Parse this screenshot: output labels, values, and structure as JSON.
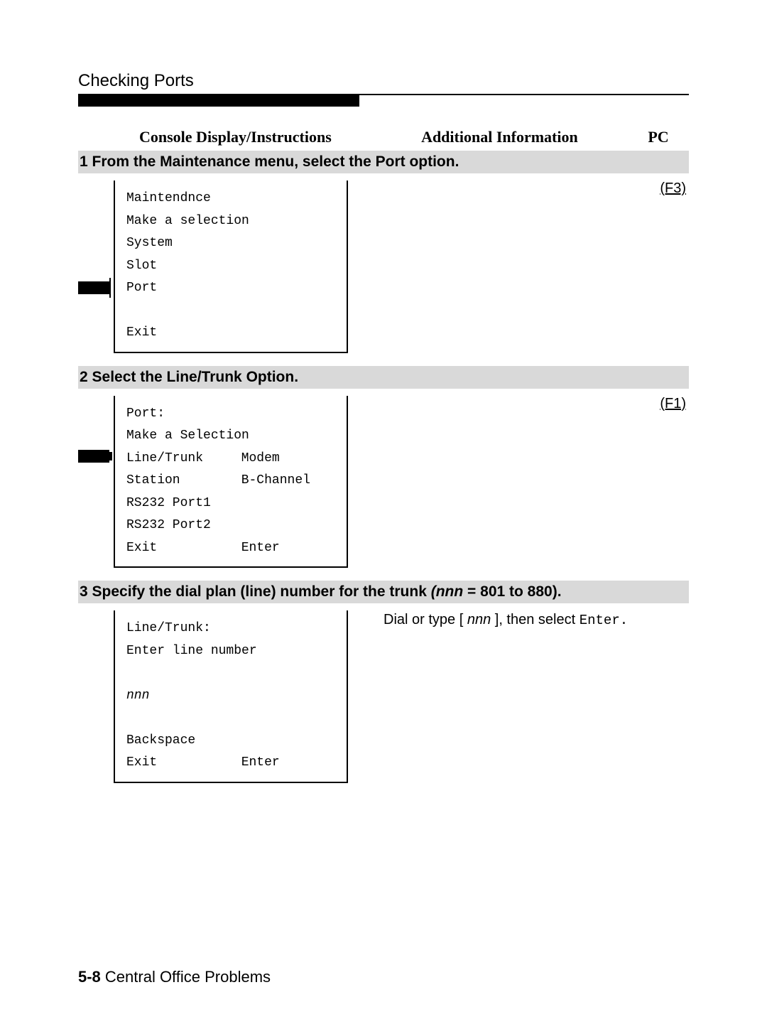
{
  "page_title": "Checking Ports",
  "headers": {
    "console": "Console Display/Instructions",
    "addl": "Additional Information",
    "pc": "PC"
  },
  "steps": {
    "s1": {
      "title": "1 From the Maintenance menu, select the Port option.",
      "lines": {
        "l1": "Maintendnce",
        "l2": "Make a selection",
        "l3": "System",
        "l4": "Slot",
        "l5": "Port",
        "l6": "Exit"
      },
      "fkey": "(F3)"
    },
    "s2": {
      "title": "2 Select the Line/Trunk Option.",
      "lines": {
        "l1": "Port:",
        "l2": "Make a Selection",
        "l3a": "Line/Trunk",
        "l3b": "Modem",
        "l4a": "Station",
        "l4b": "B-Channel",
        "l5": "RS232 Port1",
        "l6": "RS232 Port2",
        "l7a": "Exit",
        "l7b": "Enter"
      },
      "fkey": "(F1)"
    },
    "s3": {
      "title_pre": "3 Specify the dial plan (line) number for the trunk ",
      "title_it": "(nnn",
      "title_post": " = 801 to 880).",
      "lines": {
        "l1": "Line/Trunk:",
        "l2": "Enter line number",
        "l3": "nnn",
        "l4": "Backspace",
        "l5a": "Exit",
        "l5b": "Enter"
      },
      "instr_pre": "Dial or type [ ",
      "instr_it": "nnn",
      "instr_mid": " ], then select ",
      "instr_mono": "Enter.",
      "instr_post": ""
    }
  },
  "footer": {
    "num": "5-8",
    "text": " Central Office Problems"
  }
}
